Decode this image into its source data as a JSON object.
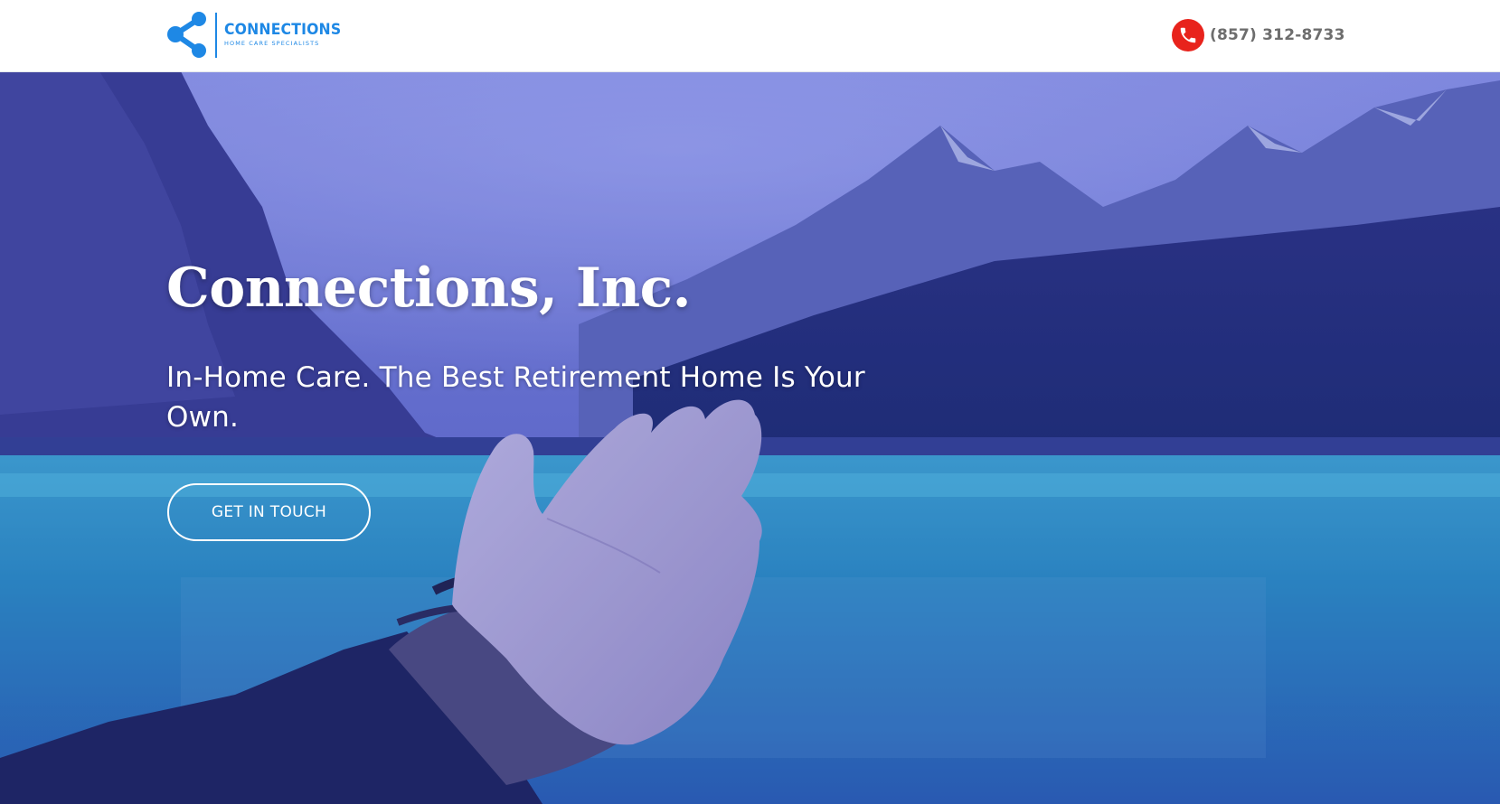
{
  "colors": {
    "brand_blue": "#1e88e5",
    "phone_red": "#e8231c",
    "phone_text": "#6d6d6d",
    "hero_overlay": "#2b3bbd"
  },
  "header": {
    "logo": {
      "name": "CONNECTIONS",
      "tagline": "HOME CARE SPECIALISTS",
      "icon": "share-nodes-icon"
    },
    "phone": {
      "icon": "phone-icon",
      "number": "(857) 312-8733"
    }
  },
  "hero": {
    "title": "Connections, Inc.",
    "subtitle": "In-Home Care. The Best Retirement Home Is Your Own.",
    "cta_label": "GET IN TOUCH"
  }
}
